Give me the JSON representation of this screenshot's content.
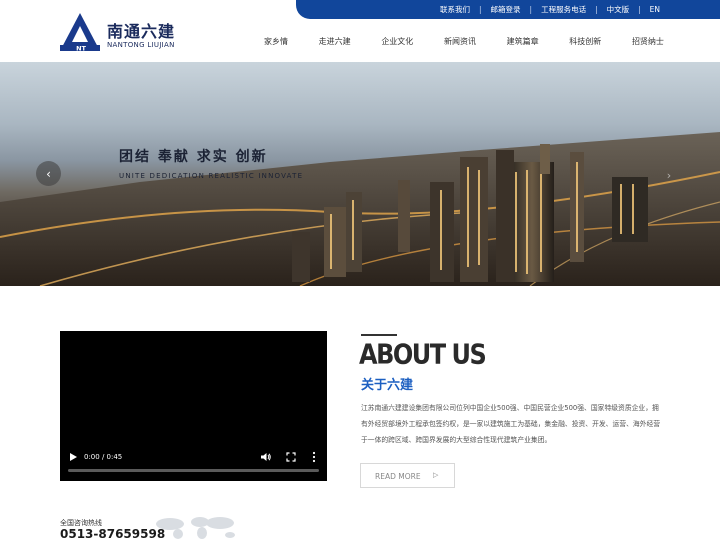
{
  "brand": {
    "name_cn": "南通六建",
    "name_en": "NANTONG LIUJIAN",
    "logo_mark": "NT",
    "logo_color": "#1a3a8c"
  },
  "topbar": {
    "bg_color": "#11469b",
    "links": [
      "联系我们",
      "邮箱登录",
      "工程服务电话",
      "中文版",
      "EN"
    ]
  },
  "nav": {
    "items": [
      "家乡情",
      "走进六建",
      "企业文化",
      "新闻资讯",
      "建筑篇章",
      "科技创新",
      "招贤纳士"
    ]
  },
  "hero": {
    "title": "团结  奉献  求实  创新",
    "subtitle": "UNITE  DEDICATION  REALISTIC  INNOVATE",
    "prev_icon": "chevron-left-icon",
    "next_icon": "chevron-right-icon"
  },
  "video": {
    "time": "0:00 / 0:45",
    "progress": 0
  },
  "about": {
    "title": "ABOUT US",
    "subtitle": "关于六建",
    "accent_color": "#1c5fc1",
    "text": "江苏南通六建建设集团有限公司位列中国企业500强、中国民营企业500强、国家特级资质企业，拥有外经贸部境外工程承包签约权，是一家以建筑施工为基础，集金融、投资、开发、运营、海外经营于一体的跨区域、跨国界发展的大型综合性现代建筑产业集团。",
    "read_more": "READ MORE"
  },
  "hotline": {
    "label": "全国咨询热线",
    "number": "0513-87659598"
  }
}
